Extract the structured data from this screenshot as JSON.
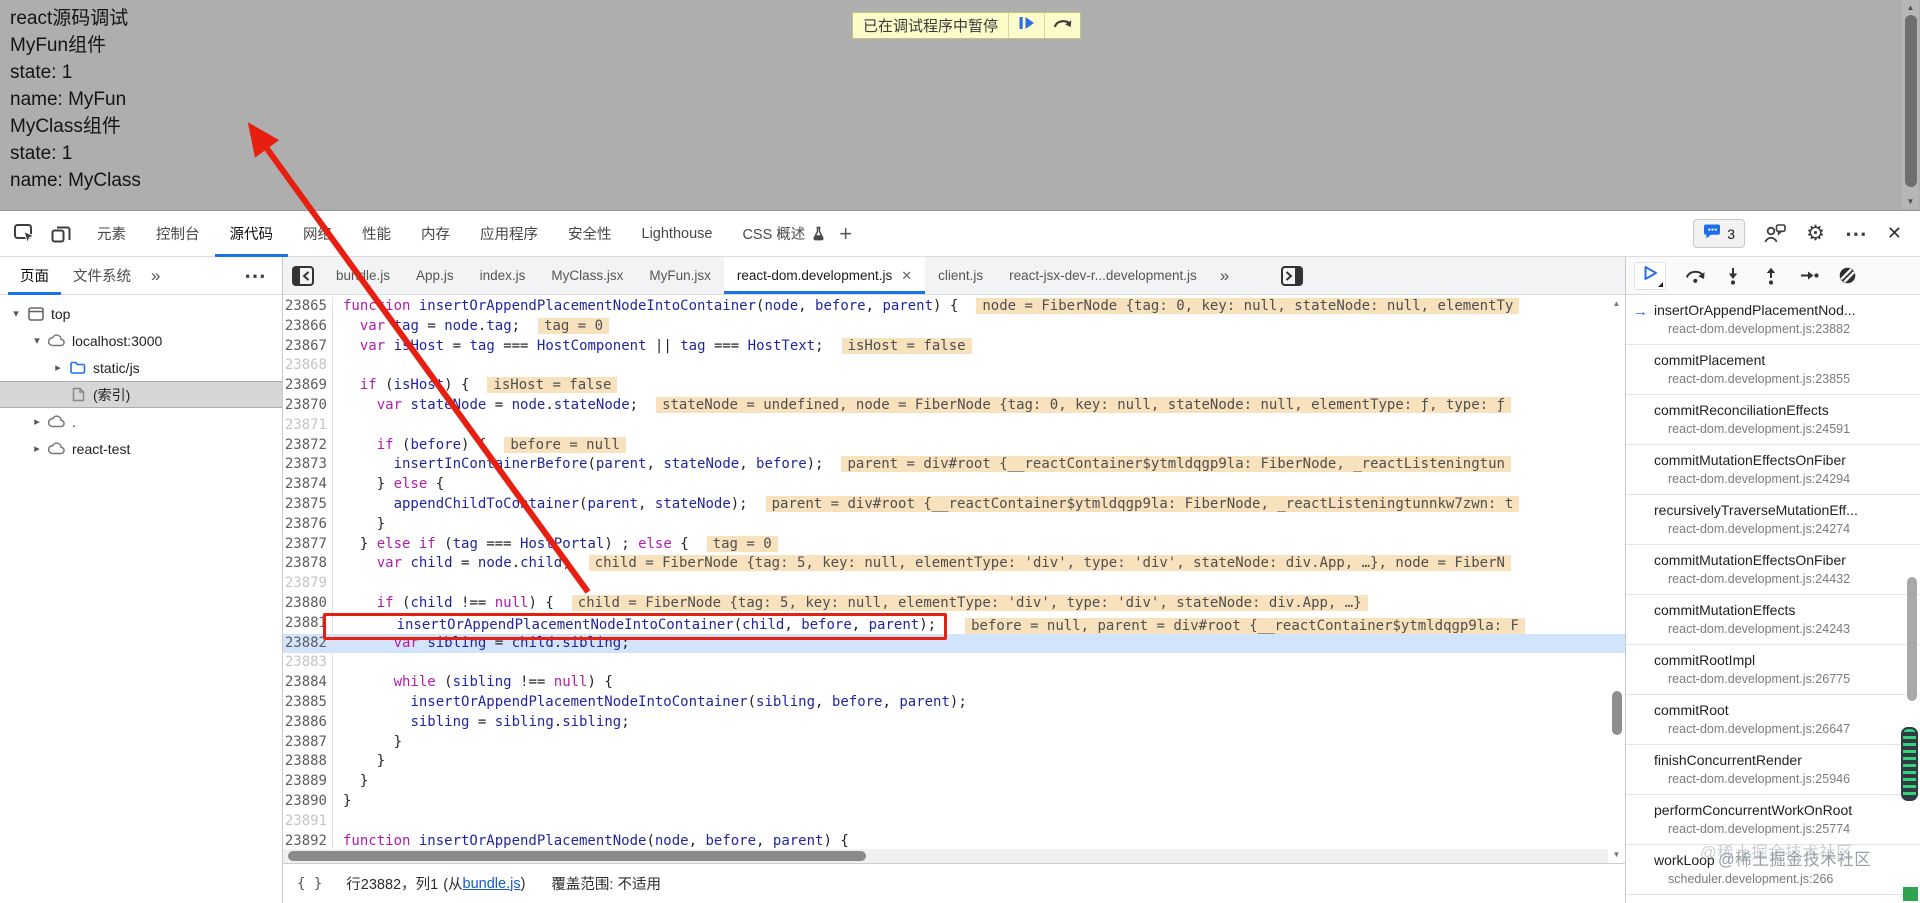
{
  "page": {
    "lines": [
      "react源码调试",
      "MyFun组件",
      "state: 1",
      "name: MyFun",
      "MyClass组件",
      "state: 1",
      "name: MyClass"
    ],
    "paused_banner": {
      "text": "已在调试程序中暂停",
      "icons": [
        "resume-icon",
        "step-icon"
      ]
    }
  },
  "devtools": {
    "main_tabs": [
      "元素",
      "控制台",
      "源代码",
      "网络",
      "性能",
      "内存",
      "应用程序",
      "安全性",
      "Lighthouse",
      "CSS 概述"
    ],
    "active_main_tab": "源代码",
    "console_badge": "3",
    "right_icons": [
      "console-messages-icon",
      "feedback-icon",
      "gear-icon",
      "more-icon",
      "close-icon"
    ],
    "sidebar": {
      "tabs": [
        "页面",
        "文件系统"
      ],
      "active_tab": "页面",
      "tree": [
        {
          "label": "top",
          "icon": "frame",
          "depth": 0,
          "exp": "open",
          "selected": false
        },
        {
          "label": "localhost:3000",
          "icon": "cloud",
          "depth": 1,
          "exp": "open",
          "selected": false
        },
        {
          "label": "static/js",
          "icon": "folder",
          "depth": 2,
          "exp": "closed",
          "selected": false
        },
        {
          "label": "(索引)",
          "icon": "doc",
          "depth": 2,
          "exp": "none",
          "selected": true
        },
        {
          "label": ".",
          "icon": "cloud",
          "depth": 1,
          "exp": "closed",
          "selected": false
        },
        {
          "label": "react-test",
          "icon": "cloud",
          "depth": 1,
          "exp": "closed",
          "selected": false
        }
      ]
    },
    "editor": {
      "tabs": [
        {
          "label": "bundle.js"
        },
        {
          "label": "App.js"
        },
        {
          "label": "index.js"
        },
        {
          "label": "MyClass.jsx"
        },
        {
          "label": "MyFun.jsx"
        },
        {
          "label": "react-dom.development.js",
          "active": true
        },
        {
          "label": "client.js"
        },
        {
          "label": "react-jsx-dev-r...development.js"
        }
      ],
      "code": [
        {
          "n": "23865",
          "tokens": [
            [
              "k",
              "function "
            ],
            [
              "n",
              "insertOrAppendPlacementNodeIntoContainer"
            ],
            [
              "p",
              "("
            ],
            [
              "n",
              "node"
            ],
            [
              "p",
              ", "
            ],
            [
              "n",
              "before"
            ],
            [
              "p",
              ", "
            ],
            [
              "n",
              "parent"
            ],
            [
              "p",
              ") {"
            ]
          ],
          "hint": "node = FiberNode {tag: 0, key: null, stateNode: null, elementTy"
        },
        {
          "n": "23866",
          "tokens": [
            [
              "p",
              "  "
            ],
            [
              "k",
              "var"
            ],
            [
              "p",
              " "
            ],
            [
              "n",
              "tag"
            ],
            [
              "p",
              " = "
            ],
            [
              "n",
              "node"
            ],
            [
              "p",
              "."
            ],
            [
              "n",
              "tag"
            ],
            [
              "p",
              ";"
            ]
          ],
          "hint": "tag = 0"
        },
        {
          "n": "23867",
          "tokens": [
            [
              "p",
              "  "
            ],
            [
              "k",
              "var"
            ],
            [
              "p",
              " "
            ],
            [
              "n",
              "isHost"
            ],
            [
              "p",
              " = "
            ],
            [
              "n",
              "tag"
            ],
            [
              "p",
              " === "
            ],
            [
              "n",
              "HostComponent"
            ],
            [
              "p",
              " || "
            ],
            [
              "n",
              "tag"
            ],
            [
              "p",
              " === "
            ],
            [
              "n",
              "HostText"
            ],
            [
              "p",
              ";"
            ]
          ],
          "hint": "isHost = false"
        },
        {
          "n": "23868",
          "dim": true,
          "tokens": []
        },
        {
          "n": "23869",
          "tokens": [
            [
              "p",
              "  "
            ],
            [
              "k",
              "if"
            ],
            [
              "p",
              " ("
            ],
            [
              "n",
              "isHost"
            ],
            [
              "p",
              ") {"
            ]
          ],
          "hint": "isHost = false"
        },
        {
          "n": "23870",
          "tokens": [
            [
              "p",
              "    "
            ],
            [
              "k",
              "var"
            ],
            [
              "p",
              " "
            ],
            [
              "n",
              "stateNode"
            ],
            [
              "p",
              " = "
            ],
            [
              "n",
              "node"
            ],
            [
              "p",
              "."
            ],
            [
              "n",
              "stateNode"
            ],
            [
              "p",
              ";"
            ]
          ],
          "hint": "stateNode = undefined, node = FiberNode {tag: 0, key: null, stateNode: null, elementType: ƒ, type: ƒ"
        },
        {
          "n": "23871",
          "dim": true,
          "tokens": []
        },
        {
          "n": "23872",
          "tokens": [
            [
              "p",
              "    "
            ],
            [
              "k",
              "if"
            ],
            [
              "p",
              " ("
            ],
            [
              "n",
              "before"
            ],
            [
              "p",
              ") {"
            ]
          ],
          "hint": "before = null"
        },
        {
          "n": "23873",
          "tokens": [
            [
              "p",
              "      "
            ],
            [
              "n",
              "insertInContainerBefore"
            ],
            [
              "p",
              "("
            ],
            [
              "n",
              "parent"
            ],
            [
              "p",
              ", "
            ],
            [
              "n",
              "stateNode"
            ],
            [
              "p",
              ", "
            ],
            [
              "n",
              "before"
            ],
            [
              "p",
              ");"
            ]
          ],
          "hint": "parent = div#root {__reactContainer$ytmldqgp9la: FiberNode, _reactListeningtun"
        },
        {
          "n": "23874",
          "tokens": [
            [
              "p",
              "    } "
            ],
            [
              "k",
              "else"
            ],
            [
              "p",
              " {"
            ]
          ]
        },
        {
          "n": "23875",
          "tokens": [
            [
              "p",
              "      "
            ],
            [
              "n",
              "appendChildToContainer"
            ],
            [
              "p",
              "("
            ],
            [
              "n",
              "parent"
            ],
            [
              "p",
              ", "
            ],
            [
              "n",
              "stateNode"
            ],
            [
              "p",
              ");"
            ]
          ],
          "hint": "parent = div#root {__reactContainer$ytmldqgp9la: FiberNode, _reactListeningtunnkw7zwn: t"
        },
        {
          "n": "23876",
          "tokens": [
            [
              "p",
              "    }"
            ]
          ]
        },
        {
          "n": "23877",
          "tokens": [
            [
              "p",
              "  } "
            ],
            [
              "k",
              "else"
            ],
            [
              "p",
              " "
            ],
            [
              "k",
              "if"
            ],
            [
              "p",
              " ("
            ],
            [
              "n",
              "tag"
            ],
            [
              "p",
              " === "
            ],
            [
              "n",
              "HostPortal"
            ],
            [
              "p",
              ") ; "
            ],
            [
              "k",
              "else"
            ],
            [
              "p",
              " {"
            ]
          ],
          "hint": "tag = 0"
        },
        {
          "n": "23878",
          "tokens": [
            [
              "p",
              "    "
            ],
            [
              "k",
              "var"
            ],
            [
              "p",
              " "
            ],
            [
              "n",
              "child"
            ],
            [
              "p",
              " = "
            ],
            [
              "n",
              "node"
            ],
            [
              "p",
              "."
            ],
            [
              "n",
              "child"
            ],
            [
              "p",
              ";"
            ]
          ],
          "hint": "child = FiberNode {tag: 5, key: null, elementType: 'div', type: 'div', stateNode: div.App, …}, node = FiberN"
        },
        {
          "n": "23879",
          "dim": true,
          "tokens": []
        },
        {
          "n": "23880",
          "tokens": [
            [
              "p",
              "    "
            ],
            [
              "k",
              "if"
            ],
            [
              "p",
              " ("
            ],
            [
              "n",
              "child"
            ],
            [
              "p",
              " !== "
            ],
            [
              "k",
              "null"
            ],
            [
              "p",
              ") {"
            ]
          ],
          "hint": "child = FiberNode {tag: 5, key: null, elementType: 'div', type: 'div', stateNode: div.App, …}"
        },
        {
          "n": "23881",
          "boxed": true,
          "tokens": [
            [
              "p",
              "      "
            ],
            [
              "n",
              "insertOrAppendPlacementNodeIntoContainer"
            ],
            [
              "p",
              "("
            ],
            [
              "n",
              "child"
            ],
            [
              "p",
              ", "
            ],
            [
              "n",
              "before"
            ],
            [
              "p",
              ", "
            ],
            [
              "n",
              "parent"
            ],
            [
              "p",
              ");"
            ]
          ],
          "hint": "before = null, parent = div#root {__reactContainer$ytmldqgp9la: F"
        },
        {
          "n": "23882",
          "exec": true,
          "tokens": [
            [
              "p",
              "      "
            ],
            [
              "k",
              "var"
            ],
            [
              "p",
              " "
            ],
            [
              "n",
              "sibling"
            ],
            [
              "p",
              " = "
            ],
            [
              "n",
              "child"
            ],
            [
              "p",
              "."
            ],
            [
              "n",
              "sibling"
            ],
            [
              "p",
              ";"
            ]
          ]
        },
        {
          "n": "23883",
          "dim": true,
          "tokens": []
        },
        {
          "n": "23884",
          "tokens": [
            [
              "p",
              "      "
            ],
            [
              "k",
              "while"
            ],
            [
              "p",
              " ("
            ],
            [
              "n",
              "sibling"
            ],
            [
              "p",
              " !== "
            ],
            [
              "k",
              "null"
            ],
            [
              "p",
              ") {"
            ]
          ]
        },
        {
          "n": "23885",
          "tokens": [
            [
              "p",
              "        "
            ],
            [
              "n",
              "insertOrAppendPlacementNodeIntoContainer"
            ],
            [
              "p",
              "("
            ],
            [
              "n",
              "sibling"
            ],
            [
              "p",
              ", "
            ],
            [
              "n",
              "before"
            ],
            [
              "p",
              ", "
            ],
            [
              "n",
              "parent"
            ],
            [
              "p",
              ");"
            ]
          ]
        },
        {
          "n": "23886",
          "tokens": [
            [
              "p",
              "        "
            ],
            [
              "n",
              "sibling"
            ],
            [
              "p",
              " = "
            ],
            [
              "n",
              "sibling"
            ],
            [
              "p",
              "."
            ],
            [
              "n",
              "sibling"
            ],
            [
              "p",
              ";"
            ]
          ]
        },
        {
          "n": "23887",
          "tokens": [
            [
              "p",
              "      }"
            ]
          ]
        },
        {
          "n": "23888",
          "tokens": [
            [
              "p",
              "    }"
            ]
          ]
        },
        {
          "n": "23889",
          "tokens": [
            [
              "p",
              "  }"
            ]
          ]
        },
        {
          "n": "23890",
          "tokens": [
            [
              "p",
              "}"
            ]
          ]
        },
        {
          "n": "23891",
          "dim": true,
          "tokens": []
        },
        {
          "n": "23892",
          "tokens": [
            [
              "k",
              "function "
            ],
            [
              "n",
              "insertOrAppendPlacementNode"
            ],
            [
              "p",
              "("
            ],
            [
              "n",
              "node"
            ],
            [
              "p",
              ", "
            ],
            [
              "n",
              "before"
            ],
            [
              "p",
              ", "
            ],
            [
              "n",
              "parent"
            ],
            [
              "p",
              ") {"
            ]
          ]
        }
      ],
      "status": {
        "position": "行23882，列1",
        "from_prefix": "(从",
        "source_link": "bundle.js",
        "from_suffix": ")",
        "coverage": "覆盖范围: 不适用"
      }
    },
    "debug_toolbar": {
      "icons": [
        "resume-icon",
        "step-over-icon",
        "step-into-icon",
        "step-out-icon",
        "step-icon",
        "deactivate-breakpoints-icon"
      ]
    },
    "callstack": [
      {
        "fn": "insertOrAppendPlacementNod...",
        "loc": "react-dom.development.js:23882",
        "current": true
      },
      {
        "fn": "commitPlacement",
        "loc": "react-dom.development.js:23855"
      },
      {
        "fn": "commitReconciliationEffects",
        "loc": "react-dom.development.js:24591"
      },
      {
        "fn": "commitMutationEffectsOnFiber",
        "loc": "react-dom.development.js:24294"
      },
      {
        "fn": "recursivelyTraverseMutationEff...",
        "loc": "react-dom.development.js:24274"
      },
      {
        "fn": "commitMutationEffectsOnFiber",
        "loc": "react-dom.development.js:24432"
      },
      {
        "fn": "commitMutationEffects",
        "loc": "react-dom.development.js:24243"
      },
      {
        "fn": "commitRootImpl",
        "loc": "react-dom.development.js:26775"
      },
      {
        "fn": "commitRoot",
        "loc": "react-dom.development.js:26647"
      },
      {
        "fn": "finishConcurrentRender",
        "loc": "react-dom.development.js:25946"
      },
      {
        "fn": "performConcurrentWorkOnRoot",
        "loc": "react-dom.development.js:25774"
      },
      {
        "fn": "workLoop",
        "loc": "scheduler.development.js:266"
      }
    ]
  },
  "watermark": "@稀土掘金技术社区",
  "colors": {
    "accent": "#1a73e8",
    "annotation": "#e71f10",
    "hint_bg": "#f8e2bd",
    "exec_line_bg": "#d2e3fc",
    "paused_banner_bg": "#fcfccb"
  }
}
